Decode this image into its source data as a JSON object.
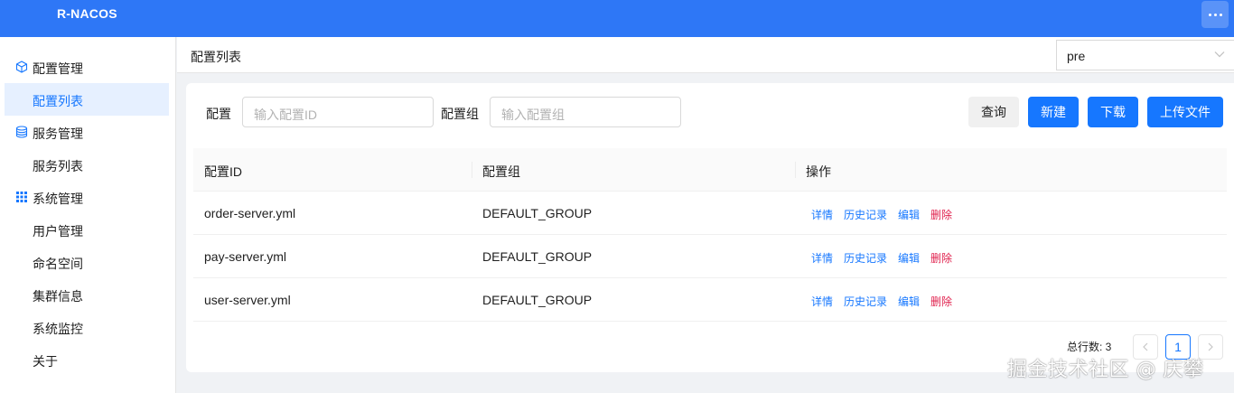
{
  "app": {
    "title": "R-NACOS"
  },
  "sidebar": {
    "groups": [
      {
        "label": "配置管理",
        "icon": "cube-icon",
        "items": [
          {
            "label": "配置列表",
            "active": true
          }
        ]
      },
      {
        "label": "服务管理",
        "icon": "database-icon",
        "items": [
          {
            "label": "服务列表",
            "active": false
          }
        ]
      },
      {
        "label": "系统管理",
        "icon": "grid-icon",
        "items": [
          {
            "label": "用户管理",
            "active": false
          },
          {
            "label": "命名空间",
            "active": false
          },
          {
            "label": "集群信息",
            "active": false
          },
          {
            "label": "系统监控",
            "active": false
          },
          {
            "label": "关于",
            "active": false
          }
        ]
      }
    ]
  },
  "header": {
    "page_title": "配置列表",
    "namespace": "pre"
  },
  "filters": {
    "config_label": "配置",
    "config_placeholder": "输入配置ID",
    "group_label": "配置组",
    "group_placeholder": "输入配置组"
  },
  "buttons": {
    "query": "查询",
    "create": "新建",
    "download": "下载",
    "upload": "上传文件"
  },
  "table": {
    "columns": [
      "配置ID",
      "配置组",
      "操作"
    ],
    "rows": [
      {
        "id": "order-server.yml",
        "group": "DEFAULT_GROUP"
      },
      {
        "id": "pay-server.yml",
        "group": "DEFAULT_GROUP"
      },
      {
        "id": "user-server.yml",
        "group": "DEFAULT_GROUP"
      }
    ],
    "actions": {
      "detail": "详情",
      "history": "历史记录",
      "edit": "编辑",
      "delete": "删除"
    }
  },
  "pagination": {
    "total_text": "总行数: 3",
    "current_page": "1"
  },
  "watermark": "掘金技术社区 @ 庆攀",
  "colors": {
    "topbar": "#2e77f6",
    "primary": "#1677ff",
    "danger": "#e0224e",
    "active_bg": "#e6f0ff"
  }
}
